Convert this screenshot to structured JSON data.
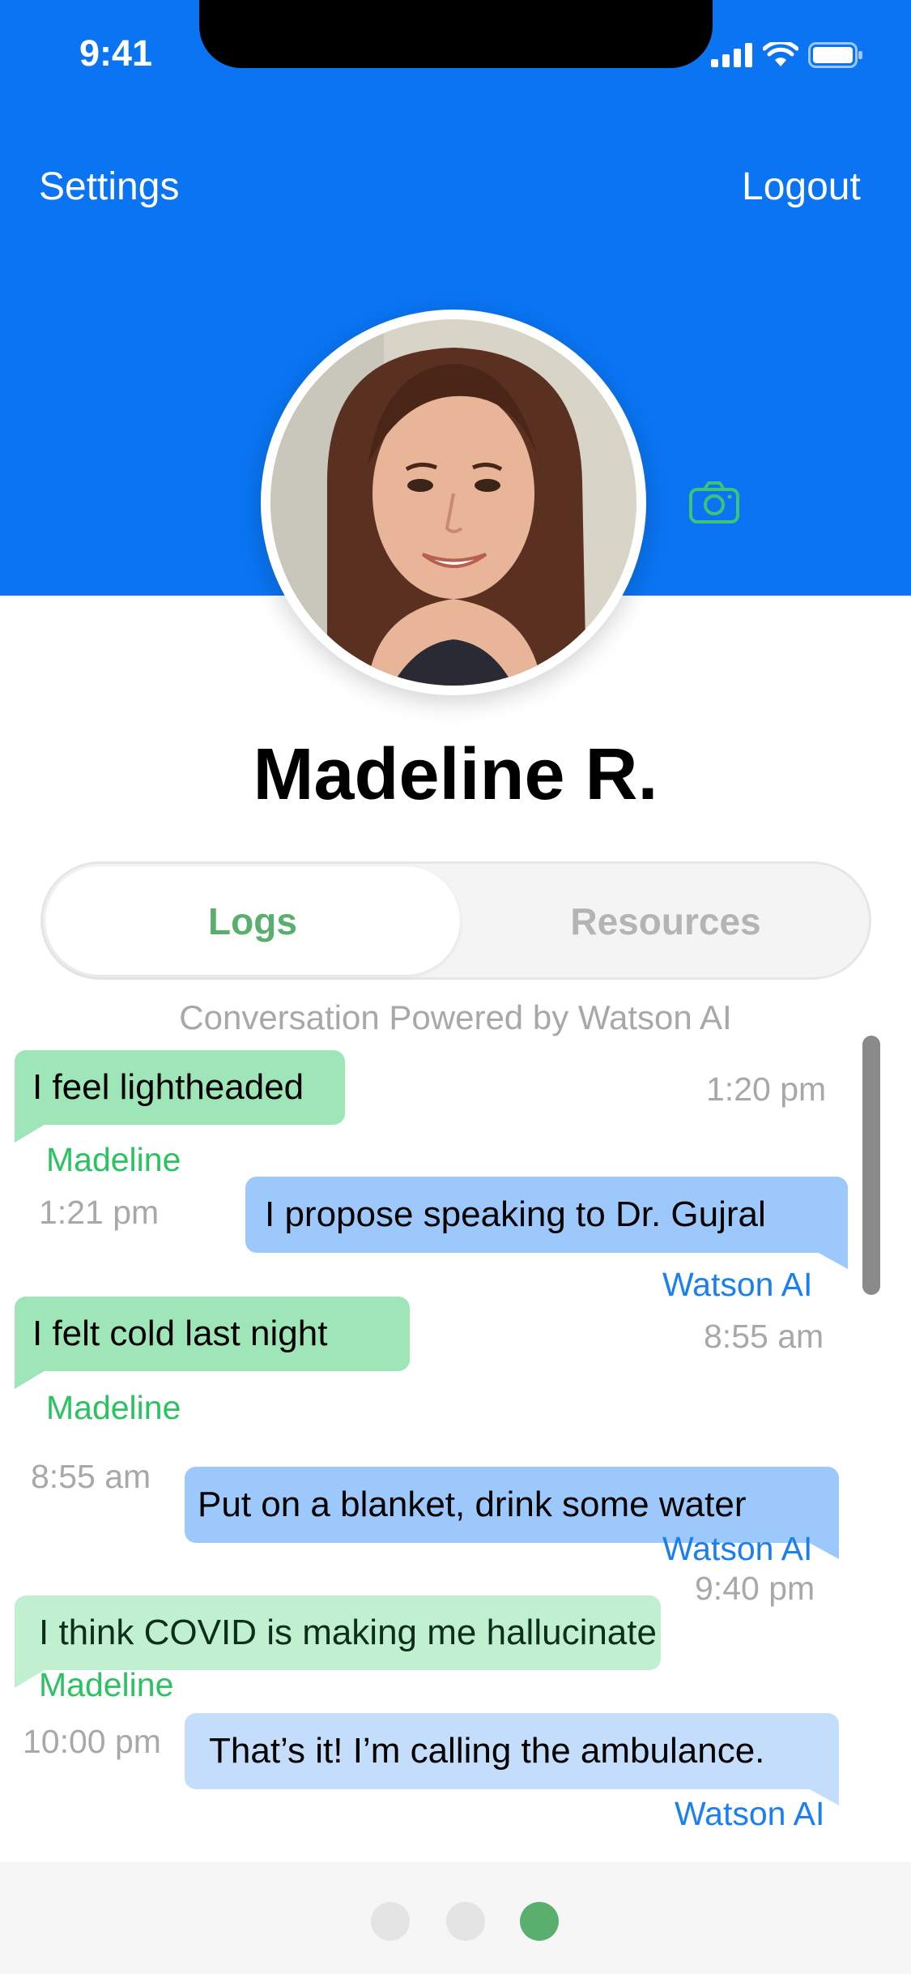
{
  "status_bar": {
    "time": "9:41"
  },
  "header": {
    "settings_label": "Settings",
    "logout_label": "Logout"
  },
  "profile": {
    "name": "Madeline R."
  },
  "tabs": [
    {
      "label": "Logs",
      "active": true
    },
    {
      "label": "Resources",
      "active": false
    }
  ],
  "conversation": {
    "powered_by": "Conversation Powered by Watson AI",
    "messages": [
      {
        "text": "I feel lightheaded",
        "sender": "Madeline",
        "time": "1:20 pm"
      },
      {
        "text": "I propose speaking to Dr. Gujral",
        "sender": "Watson AI",
        "time": "1:21 pm"
      },
      {
        "text": "I felt cold last night",
        "sender": "Madeline",
        "time": "8:55 am"
      },
      {
        "text": "Put on a blanket, drink some water",
        "sender": "Watson AI",
        "time": "8:55 am"
      },
      {
        "text": "I think COVID is making me hallucinate",
        "sender": "Madeline",
        "time": "9:40 pm"
      },
      {
        "text": "That’s it! I’m calling the ambulance.",
        "sender": "Watson AI",
        "time": "10:00 pm"
      }
    ]
  },
  "page_indicator": {
    "count": 3,
    "active_index": 2
  },
  "colors": {
    "header_blue": "#0a74f2",
    "user_bubble": "#9ee6b8",
    "ai_bubble": "#9cc8fb",
    "active_tab_text": "#5aaf6e",
    "inactive_tab_text": "#b4b4b4",
    "active_dot": "#5aaf6e",
    "inactive_dot": "#e4e4e4"
  }
}
